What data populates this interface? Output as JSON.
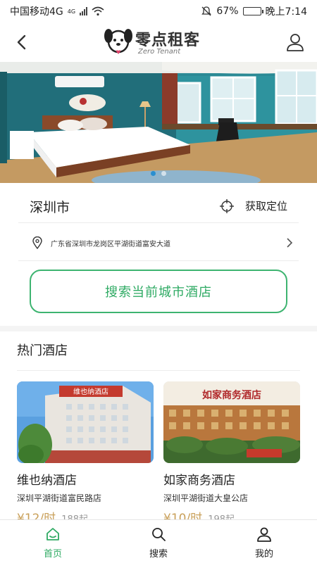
{
  "statusbar": {
    "carrier": "中国移动4G",
    "network_badge": "4G",
    "battery": "67%",
    "time": "晚上7:14",
    "battery_level": 0.67
  },
  "header": {
    "logo_title": "零点租客",
    "logo_subtitle": "Zero Tenant",
    "back_icon": "chevron-left-icon",
    "user_icon": "user-icon"
  },
  "banner": {
    "slides": 2,
    "active_slide": 0
  },
  "location": {
    "city": "深圳市",
    "locate_label": "获取定位",
    "address": "广东省深圳市龙岗区平湖街道富安大道"
  },
  "search_button_label": "搜索当前城市酒店",
  "hot": {
    "title": "热门酒店",
    "hotels": [
      {
        "name": "维也纳酒店",
        "address": "深圳平湖街道富民路店",
        "price": "¥12/时",
        "old_price": "188起",
        "sign_text": "维也纳酒店"
      },
      {
        "name": "如家商务酒店",
        "address": "深圳平湖街道大皇公店",
        "price": "¥10/时",
        "old_price": "198起",
        "sign_text": "如家商务酒店"
      }
    ]
  },
  "tabbar": {
    "tabs": [
      {
        "label": "首页",
        "icon": "home-icon",
        "active": true
      },
      {
        "label": "搜索",
        "icon": "search-icon",
        "active": false
      },
      {
        "label": "我的",
        "icon": "user-icon",
        "active": false
      }
    ]
  },
  "colors": {
    "accent": "#2eaa63",
    "price": "#c9a05a"
  }
}
